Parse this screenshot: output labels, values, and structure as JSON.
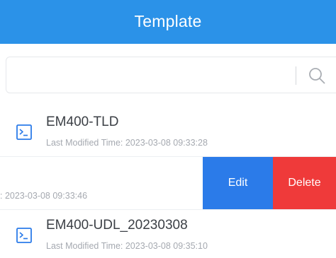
{
  "header": {
    "title": "Template"
  },
  "search": {
    "placeholder": "",
    "value": ""
  },
  "colors": {
    "header_bg": "#2b92e8",
    "edit_bg": "#2b7be9",
    "delete_bg": "#ef3a3a",
    "icon_blue": "#2b7be9"
  },
  "templates": [
    {
      "name": "EM400-TLD",
      "modified": "Last Modified Time: 2023-03-08 09:33:28",
      "icon": "terminal-file-icon"
    },
    {
      "modified_partial": ": 2023-03-08 09:33:46",
      "actions": {
        "edit": "Edit",
        "delete": "Delete"
      }
    },
    {
      "name": "EM400-UDL_20230308",
      "modified": "Last Modified Time: 2023-03-08 09:35:10",
      "icon": "terminal-file-icon"
    }
  ]
}
